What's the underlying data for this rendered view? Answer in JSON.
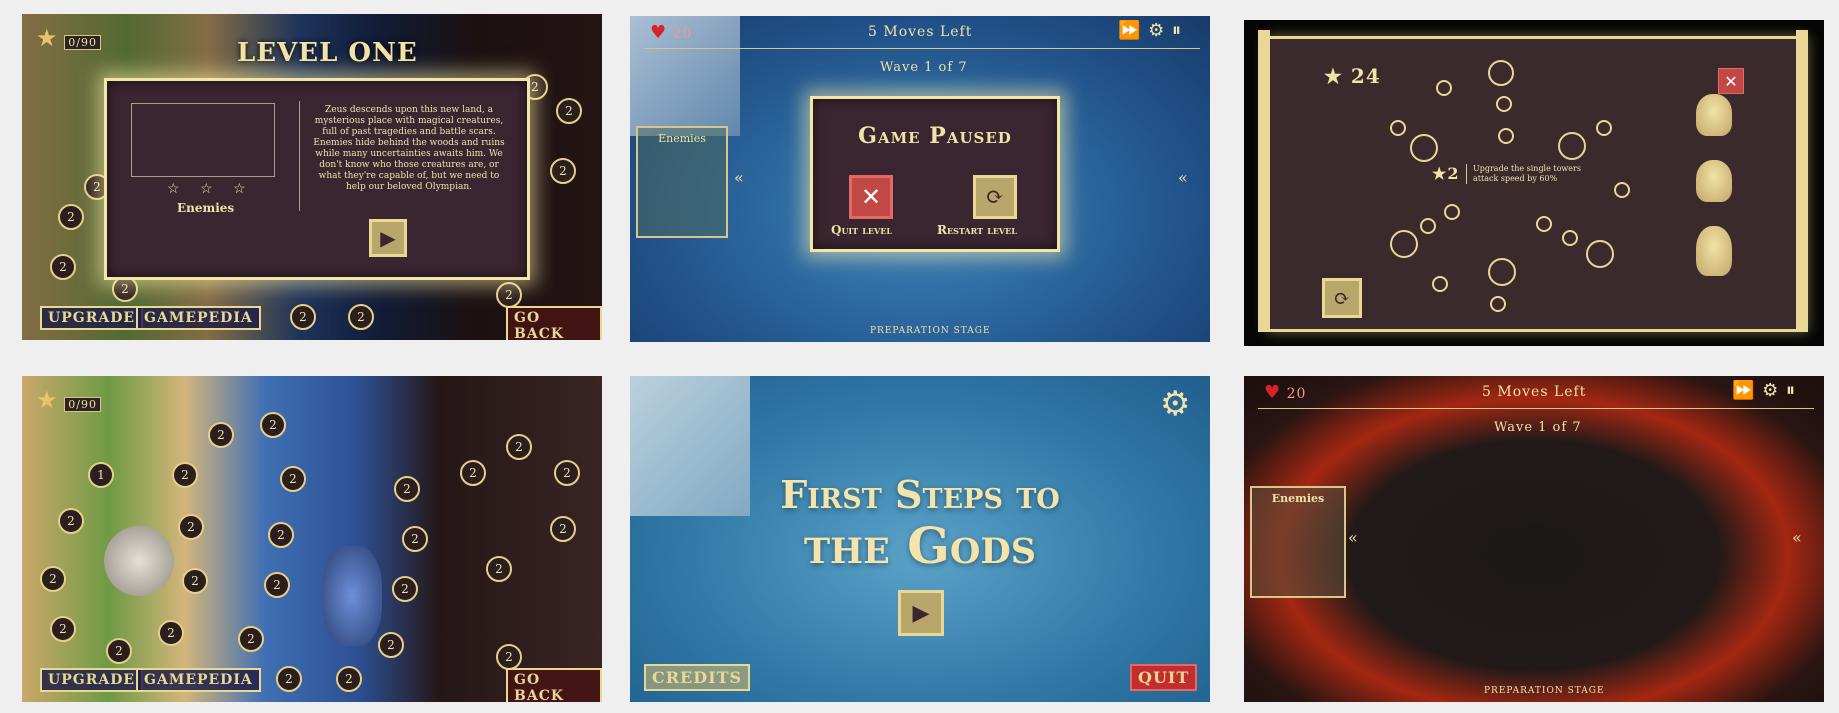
{
  "screens": {
    "level_select_1": {
      "star_count": "0/90",
      "popup_title": "LEVEL ONE",
      "enemies_label": "Enemies",
      "description": "Zeus descends upon this new land, a mysterious place with magical creatures, full of past tragedies and battle scars. Enemies hide behind the woods and ruins while many uncertainties awaits him. We don't know who those creatures are, or what they're capable of, but we need to help our beloved Olympian.",
      "stars": "☆ ☆ ☆",
      "upgrade": "UPGRADE",
      "gamepedia": "GAMEPEDIA",
      "go_back": "GO BACK",
      "nodes": [
        "2",
        "2",
        "2",
        "2",
        "2",
        "2",
        "2",
        "2",
        "2",
        "2"
      ]
    },
    "pause": {
      "hearts": "20",
      "moves": "5 Moves Left",
      "wave": "Wave 1 of 7",
      "enemies": "Enemies",
      "title": "Game Paused",
      "quit": "Quit level",
      "restart": "Restart level",
      "stage": "PREPARATION STAGE"
    },
    "upgrade": {
      "stars": "24",
      "cost": "2",
      "tooltip": "Upgrade the single towers attack speed by 60%"
    },
    "level_select_2": {
      "star_count": "0/90",
      "upgrade": "UPGRADE",
      "gamepedia": "GAMEPEDIA",
      "go_back": "GO BACK",
      "nodes": [
        "2",
        "1",
        "2",
        "2",
        "2",
        "2",
        "2",
        "2",
        "2",
        "2",
        "2",
        "2",
        "2",
        "2",
        "2",
        "2",
        "2",
        "2",
        "2",
        "2",
        "2",
        "2",
        "2",
        "2",
        "2",
        "2",
        "2"
      ]
    },
    "title": {
      "title_line1": "First Steps to",
      "title_line2": "the Gods",
      "credits": "CREDITS",
      "quit": "QUIT"
    },
    "lava": {
      "hearts": "20",
      "moves": "5 Moves Left",
      "wave": "Wave 1 of 7",
      "enemies": "Enemies",
      "stage": "PREPARATION STAGE"
    }
  },
  "colors": {
    "gold": "#f1e2a8",
    "water": "#2e6fa6",
    "panel": "#3b2530",
    "red_heart": "#d8232a"
  }
}
